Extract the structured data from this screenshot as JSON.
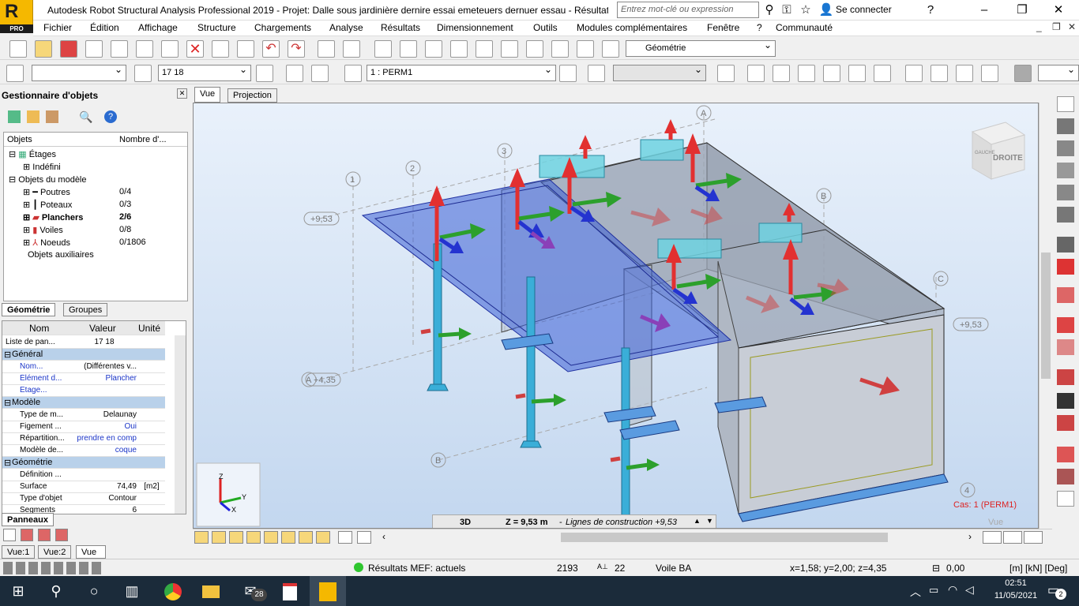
{
  "app": {
    "logo_letter": "R",
    "logo_sub": "PRO",
    "title": "Autodesk Robot Structural Analysis Professional 2019 - Projet: Dalle sous jardinière dernire essai emeteuers dernuer essau - Résultats ...",
    "search_placeholder": "Entrez mot-clé ou expression",
    "signin": "Se connecter"
  },
  "menu": [
    "Fichier",
    "Édition",
    "Affichage",
    "Structure",
    "Chargements",
    "Analyse",
    "Résultats",
    "Dimensionnement",
    "Outils",
    "Modules complémentaires",
    "Fenêtre",
    "?",
    "Communauté"
  ],
  "toolbar": {
    "geometry_combo": "Géométrie",
    "selection_combo": "17 18",
    "case_combo": "1 : PERM1"
  },
  "objmgr": {
    "title": "Gestionnaire d'objets",
    "col_objects": "Objets",
    "col_count": "Nombre d'...",
    "tree": [
      {
        "label": "Étages",
        "count": ""
      },
      {
        "label": "Indéfini",
        "count": ""
      },
      {
        "label": "Objets du modèle",
        "count": ""
      },
      {
        "label": "Poutres",
        "count": "0/4"
      },
      {
        "label": "Poteaux",
        "count": "0/3"
      },
      {
        "label": "Planchers",
        "count": "2/6"
      },
      {
        "label": "Voiles",
        "count": "0/8"
      },
      {
        "label": "Noeuds",
        "count": "0/1806"
      },
      {
        "label": "Objets auxiliaires",
        "count": ""
      }
    ],
    "tabs": [
      "Géométrie",
      "Groupes"
    ]
  },
  "props": {
    "head": [
      "Nom",
      "Valeur",
      "Unité"
    ],
    "rows": [
      {
        "k": "Liste de pan...",
        "v": "17 18",
        "u": ""
      },
      {
        "k": "Général",
        "v": "",
        "u": "",
        "sect": true
      },
      {
        "k": "Nom...",
        "v": "(Différentes v...",
        "u": ""
      },
      {
        "k": "Élément d...",
        "v": "Plancher",
        "u": ""
      },
      {
        "k": "Etage...",
        "v": "",
        "u": ""
      },
      {
        "k": "Modèle",
        "v": "",
        "u": "",
        "sect": true
      },
      {
        "k": "Type de m...",
        "v": "Delaunay",
        "u": ""
      },
      {
        "k": "Figement ...",
        "v": "Oui",
        "u": ""
      },
      {
        "k": "Répartition...",
        "v": "prendre en comp",
        "u": ""
      },
      {
        "k": "Modèle de...",
        "v": "coque",
        "u": ""
      },
      {
        "k": "Géométrie",
        "v": "",
        "u": "",
        "sect": true
      },
      {
        "k": "Définition ...",
        "v": "",
        "u": ""
      },
      {
        "k": "Surface",
        "v": "74,49",
        "u": "[m2]"
      },
      {
        "k": "Type d'objet",
        "v": "Contour",
        "u": ""
      },
      {
        "k": "Segments",
        "v": "6",
        "u": ""
      }
    ],
    "tab": "Panneaux"
  },
  "view": {
    "tabs": [
      "Vue",
      "Projection"
    ],
    "cube_label": "DROITE",
    "cube_side": "GAUCHE",
    "mode": "3D",
    "zinfo": "Z = 9,53 m",
    "zinfo2": "Lignes de construction +9,53",
    "case_label": "Cas: 1 (PERM1)",
    "vue_label": "Vue",
    "grid_labels": [
      "1",
      "2",
      "3",
      "A",
      "B",
      "C",
      "+9,53",
      "+9,53",
      "A",
      "+4,35",
      "B",
      "4"
    ]
  },
  "bottomtabs": [
    "Vue:1",
    "Vue:2",
    "Vue"
  ],
  "status": {
    "mef": "Résultats MEF: actuels",
    "n1": "2193",
    "n2": "22",
    "elem": "Voile BA",
    "coords": "x=1,58; y=2,00; z=4,35",
    "val": "0,00",
    "units": "[m] [kN] [Deg]"
  },
  "taskbar": {
    "mail_badge": "28",
    "time": "02:51",
    "date": "11/05/2021",
    "notif": "2"
  },
  "colors": {
    "accent": "#f5b800",
    "slab": "#3a5fd6",
    "column": "#3aaed8"
  }
}
